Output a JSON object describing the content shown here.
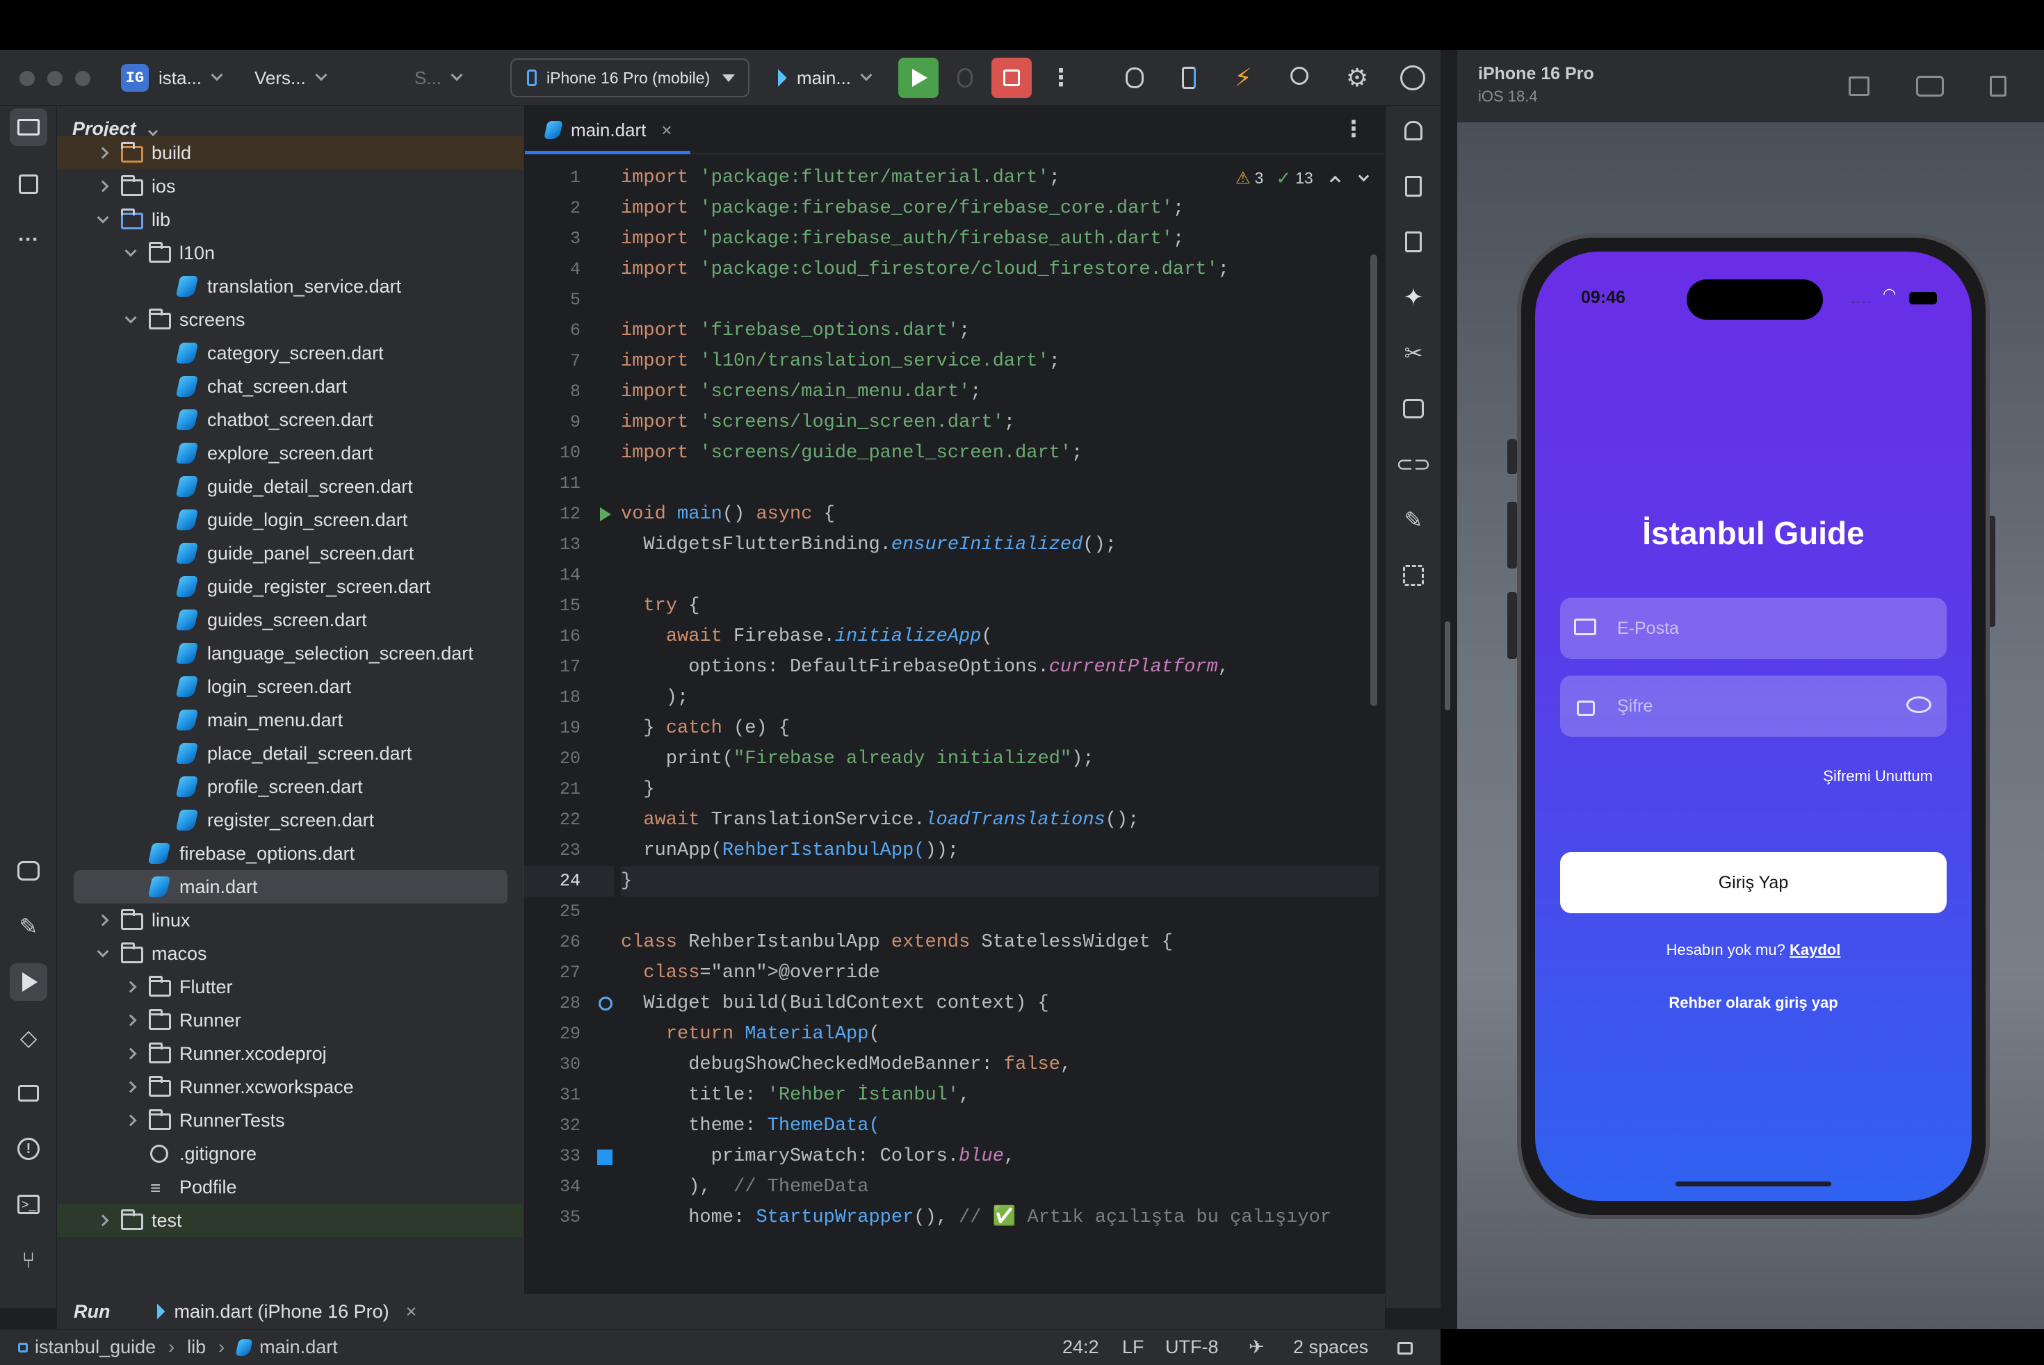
{
  "toolbar": {
    "project_badge": "IG",
    "project_name": "ista...",
    "vcs_label": "Vers...",
    "search_label": "S...",
    "device_label": "iPhone 16 Pro (mobile)",
    "run_config": "main..."
  },
  "project_panel": {
    "title": "Project",
    "tree": [
      {
        "label": "build",
        "type": "folder",
        "depth": 1,
        "state": "collapsed",
        "style": "excluded"
      },
      {
        "label": "ios",
        "type": "folder",
        "depth": 1,
        "state": "collapsed"
      },
      {
        "label": "lib",
        "type": "folder",
        "depth": 1,
        "state": "expanded",
        "style": "source"
      },
      {
        "label": "l10n",
        "type": "folder",
        "depth": 2,
        "state": "expanded"
      },
      {
        "label": "translation_service.dart",
        "type": "dart",
        "depth": 3
      },
      {
        "label": "screens",
        "type": "folder",
        "depth": 2,
        "state": "expanded"
      },
      {
        "label": "category_screen.dart",
        "type": "dart",
        "depth": 3
      },
      {
        "label": "chat_screen.dart",
        "type": "dart",
        "depth": 3
      },
      {
        "label": "chatbot_screen.dart",
        "type": "dart",
        "depth": 3
      },
      {
        "label": "explore_screen.dart",
        "type": "dart",
        "depth": 3
      },
      {
        "label": "guide_detail_screen.dart",
        "type": "dart",
        "depth": 3
      },
      {
        "label": "guide_login_screen.dart",
        "type": "dart",
        "depth": 3
      },
      {
        "label": "guide_panel_screen.dart",
        "type": "dart",
        "depth": 3
      },
      {
        "label": "guide_register_screen.dart",
        "type": "dart",
        "depth": 3
      },
      {
        "label": "guides_screen.dart",
        "type": "dart",
        "depth": 3
      },
      {
        "label": "language_selection_screen.dart",
        "type": "dart",
        "depth": 3
      },
      {
        "label": "login_screen.dart",
        "type": "dart",
        "depth": 3
      },
      {
        "label": "main_menu.dart",
        "type": "dart",
        "depth": 3
      },
      {
        "label": "place_detail_screen.dart",
        "type": "dart",
        "depth": 3
      },
      {
        "label": "profile_screen.dart",
        "type": "dart",
        "depth": 3
      },
      {
        "label": "register_screen.dart",
        "type": "dart",
        "depth": 3
      },
      {
        "label": "firebase_options.dart",
        "type": "dart",
        "depth": 2
      },
      {
        "label": "main.dart",
        "type": "dart",
        "depth": 2,
        "selected": true
      },
      {
        "label": "linux",
        "type": "folder",
        "depth": 1,
        "state": "collapsed"
      },
      {
        "label": "macos",
        "type": "folder",
        "depth": 1,
        "state": "expanded"
      },
      {
        "label": "Flutter",
        "type": "folder",
        "depth": 2,
        "state": "collapsed"
      },
      {
        "label": "Runner",
        "type": "folder",
        "depth": 2,
        "state": "collapsed"
      },
      {
        "label": "Runner.xcodeproj",
        "type": "folder",
        "depth": 2,
        "state": "collapsed"
      },
      {
        "label": "Runner.xcworkspace",
        "type": "folder",
        "depth": 2,
        "state": "collapsed"
      },
      {
        "label": "RunnerTests",
        "type": "folder",
        "depth": 2,
        "state": "collapsed"
      },
      {
        "label": ".gitignore",
        "type": "ignore",
        "depth": 2
      },
      {
        "label": "Podfile",
        "type": "text",
        "depth": 2
      },
      {
        "label": "test",
        "type": "folder",
        "depth": 1,
        "state": "collapsed",
        "style": "test"
      }
    ]
  },
  "editor": {
    "tab_label": "main.dart",
    "inspections": {
      "warnings": "3",
      "ok": "13"
    },
    "current_line": 24,
    "lines": [
      "import 'package:flutter/material.dart';",
      "import 'package:firebase_core/firebase_core.dart';",
      "import 'package:firebase_auth/firebase_auth.dart';",
      "import 'package:cloud_firestore/cloud_firestore.dart';",
      "",
      "import 'firebase_options.dart';",
      "import 'l10n/translation_service.dart';",
      "import 'screens/main_menu.dart';",
      "import 'screens/login_screen.dart';",
      "import 'screens/guide_panel_screen.dart';",
      "",
      "void main() async {",
      "  WidgetsFlutterBinding.ensureInitialized();",
      "",
      "  try {",
      "    await Firebase.initializeApp(",
      "      options: DefaultFirebaseOptions.currentPlatform,",
      "    );",
      "  } catch (e) {",
      "    print(\"Firebase already initialized\");",
      "  }",
      "  await TranslationService.loadTranslations();",
      "  runApp(RehberIstanbulApp());",
      "}",
      "",
      "class RehberIstanbulApp extends StatelessWidget {",
      "  @override",
      "  Widget build(BuildContext context) {",
      "    return MaterialApp(",
      "      debugShowCheckedModeBanner: false,",
      "      title: 'Rehber İstanbul',",
      "      theme: ThemeData(",
      "        primarySwatch: Colors.blue,",
      "      ),  // ThemeData",
      "      home: StartupWrapper(), // ✅ Artık açılışta bu çalışıyor"
    ]
  },
  "run_panel": {
    "label": "Run",
    "tab_label": "main.dart (iPhone 16 Pro)"
  },
  "status_bar": {
    "breadcrumb": [
      "istanbul_guide",
      "lib",
      "main.dart"
    ],
    "position": "24:2",
    "line_sep": "LF",
    "encoding": "UTF-8",
    "indent": "2 spaces"
  },
  "simulator": {
    "device_name": "iPhone 16 Pro",
    "os_version": "iOS 18.4",
    "time": "09:46",
    "app": {
      "title": "İstanbul Guide",
      "email_placeholder": "E-Posta",
      "password_placeholder": "Şifre",
      "forgot_password": "Şifremi Unuttum",
      "login_button": "Giriş Yap",
      "no_account": "Hesabın yok mu?",
      "register_link": "Kaydol",
      "guide_login": "Rehber olarak giriş yap"
    }
  },
  "colors": {
    "accent": "#3574f0",
    "run_green": "#4ca04c",
    "stop_red": "#d9534f",
    "app_gradient_top": "#6a2ee6",
    "app_gradient_bottom": "#2f62f0"
  }
}
